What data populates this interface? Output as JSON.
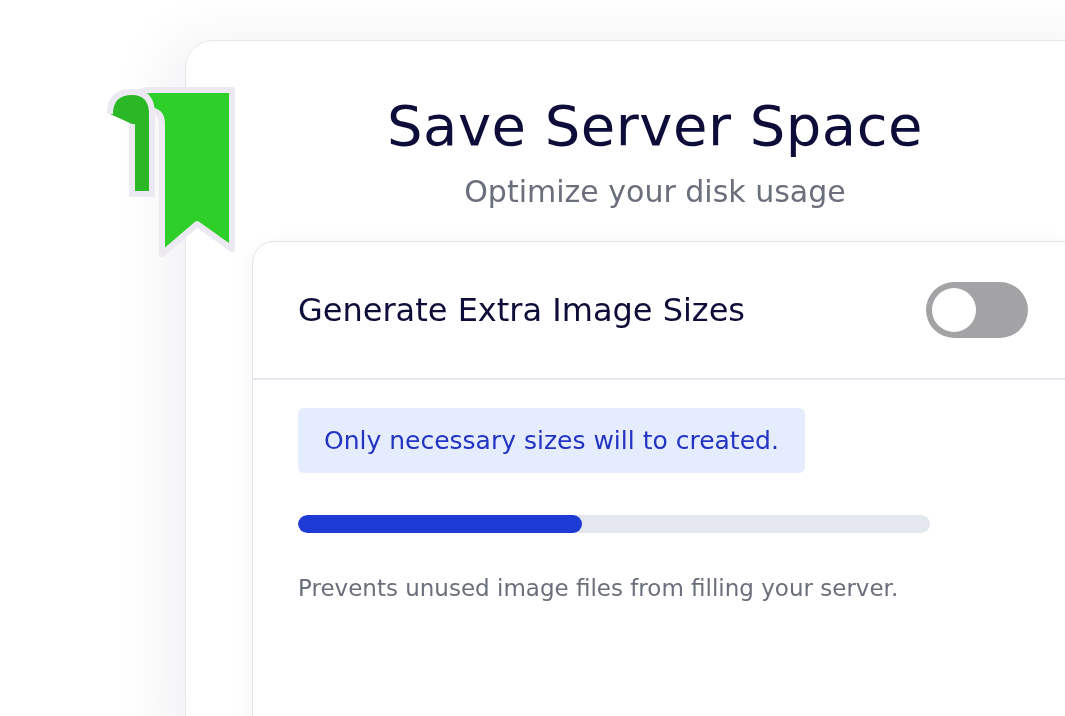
{
  "header": {
    "title": "Save Server Space",
    "subtitle": "Optimize your disk usage"
  },
  "setting": {
    "label": "Generate Extra Image Sizes",
    "on": false
  },
  "notice": "Only necessary sizes will to created.",
  "progress": {
    "level": 0.45
  },
  "description": "Prevents unused image files from filling your server."
}
